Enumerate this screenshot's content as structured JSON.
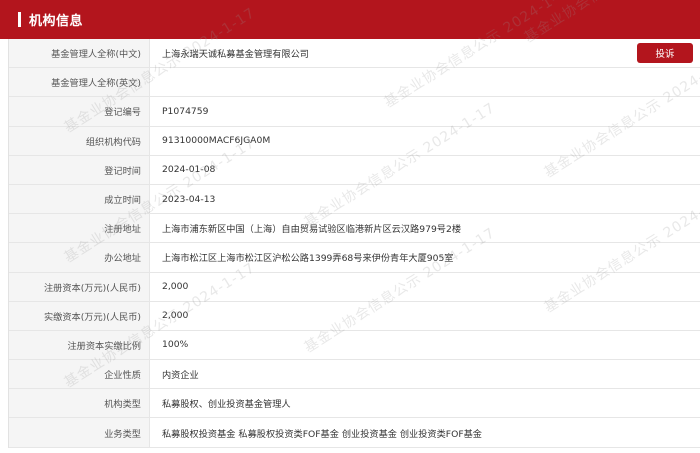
{
  "header": {
    "title": "机构信息"
  },
  "complain_button": {
    "label": "投诉"
  },
  "rows": [
    {
      "label": "基金管理人全称(中文)",
      "value": "上海永瑞天诚私募基金管理有限公司"
    },
    {
      "label": "基金管理人全称(英文)",
      "value": ""
    },
    {
      "label": "登记编号",
      "value": "P1074759"
    },
    {
      "label": "组织机构代码",
      "value": "91310000MACF6JGA0M"
    },
    {
      "label": "登记时间",
      "value": "2024-01-08"
    },
    {
      "label": "成立时间",
      "value": "2023-04-13"
    },
    {
      "label": "注册地址",
      "value": "上海市浦东新区中国（上海）自由贸易试验区临港新片区云汉路979号2楼"
    },
    {
      "label": "办公地址",
      "value": "上海市松江区上海市松江区沪松公路1399弄68号来伊份青年大厦905室"
    },
    {
      "label": "注册资本(万元)(人民币)",
      "value": "2,000"
    },
    {
      "label": "实缴资本(万元)(人民币)",
      "value": "2,000"
    },
    {
      "label": "注册资本实缴比例",
      "value": "100%"
    },
    {
      "label": "企业性质",
      "value": "内资企业"
    },
    {
      "label": "机构类型",
      "value": "私募股权、创业投资基金管理人"
    },
    {
      "label": "业务类型",
      "value": "私募股权投资基金  私募股权投资类FOF基金  创业投资基金  创业投资类FOF基金"
    }
  ],
  "watermark": {
    "text": "基金业协会信息公示 2024-1-17"
  }
}
